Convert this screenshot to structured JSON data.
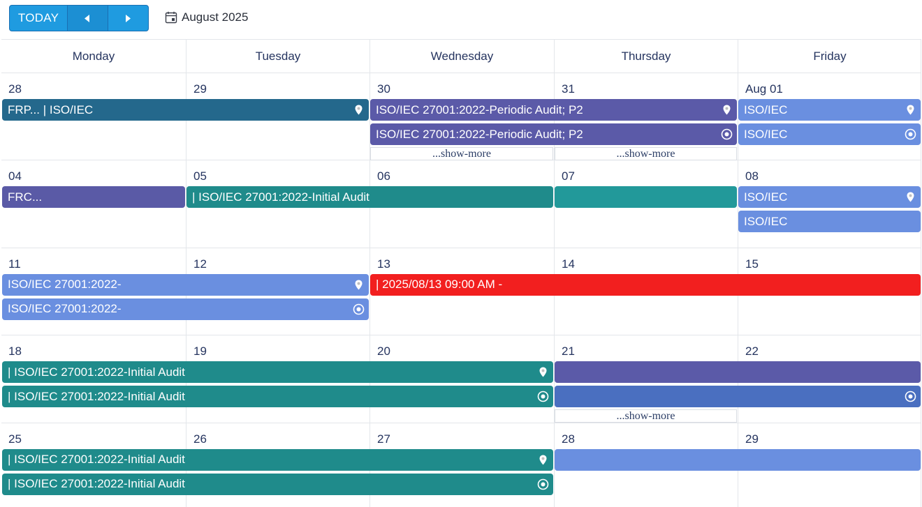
{
  "toolbar": {
    "today_label": "TODAY",
    "prev_icon": "triangle-left",
    "next_icon": "triangle-right",
    "calendar_icon": "calendar-icon",
    "month_label": "August 2025"
  },
  "weekdays": [
    "Monday",
    "Tuesday",
    "Wednesday",
    "Thursday",
    "Friday"
  ],
  "weeks": [
    {
      "days": [
        "28",
        "29",
        "30",
        "31",
        "Aug 01"
      ],
      "events": [
        {
          "col": 0,
          "span": 2,
          "lane": 0,
          "color": "#24688c",
          "title": "FRP...  | ISO/IEC",
          "icon": "location-pin-icon"
        },
        {
          "col": 2,
          "span": 2,
          "lane": 0,
          "color": "#5b5aa8",
          "title": "ISO/IEC 27001:2022-Periodic Audit; P2",
          "icon": "location-pin-icon"
        },
        {
          "col": 4,
          "span": 1,
          "lane": 0,
          "color": "#6a8fe0",
          "title": "ISO/IEC",
          "icon": "location-pin-icon"
        },
        {
          "col": 2,
          "span": 2,
          "lane": 1,
          "color": "#5b5aa8",
          "title": "ISO/IEC 27001:2022-Periodic Audit; P2",
          "icon": "target-icon"
        },
        {
          "col": 4,
          "span": 1,
          "lane": 1,
          "color": "#6a8fe0",
          "title": "ISO/IEC",
          "icon": "target-icon"
        }
      ],
      "more": [
        {
          "col": 2,
          "label": "...show-more"
        },
        {
          "col": 3,
          "label": "...show-more"
        }
      ]
    },
    {
      "days": [
        "04",
        "05",
        "06",
        "07",
        "08"
      ],
      "events": [
        {
          "col": 0,
          "span": 1,
          "lane": 0,
          "color": "#5a5aa6",
          "title": "FRC...",
          "icon": ""
        },
        {
          "col": 1,
          "span": 2,
          "lane": 0,
          "color": "#1f8b8b",
          "title": "| ISO/IEC 27001:2022-Initial Audit",
          "icon": ""
        },
        {
          "col": 3,
          "span": 1,
          "lane": 0,
          "color": "#22999a",
          "title": "",
          "icon": ""
        },
        {
          "col": 4,
          "span": 1,
          "lane": 0,
          "color": "#6a8fe0",
          "title": "ISO/IEC",
          "icon": "location-pin-icon"
        },
        {
          "col": 4,
          "span": 1,
          "lane": 1,
          "color": "#6a8fe0",
          "title": "ISO/IEC",
          "icon": ""
        }
      ],
      "more": []
    },
    {
      "days": [
        "11",
        "12",
        "13",
        "14",
        "15"
      ],
      "events": [
        {
          "col": 0,
          "span": 2,
          "lane": 0,
          "color": "#6a8fe0",
          "title": "ISO/IEC 27001:2022-",
          "icon": "location-pin-icon"
        },
        {
          "col": 2,
          "span": 3,
          "lane": 0,
          "color": "#f21f1f",
          "title": "| 2025/08/13 09:00 AM -",
          "icon": ""
        },
        {
          "col": 0,
          "span": 2,
          "lane": 1,
          "color": "#6a8fe0",
          "title": "ISO/IEC 27001:2022-",
          "icon": "target-icon"
        }
      ],
      "more": []
    },
    {
      "days": [
        "18",
        "19",
        "20",
        "21",
        "22"
      ],
      "events": [
        {
          "col": 0,
          "span": 3,
          "lane": 0,
          "color": "#1f8b8b",
          "title": "| ISO/IEC 27001:2022-Initial Audit",
          "icon": "location-pin-icon"
        },
        {
          "col": 3,
          "span": 2,
          "lane": 0,
          "color": "#5b5aa8",
          "title": "",
          "icon": ""
        },
        {
          "col": 0,
          "span": 3,
          "lane": 1,
          "color": "#1f8b8b",
          "title": "| ISO/IEC 27001:2022-Initial Audit",
          "icon": "target-icon"
        },
        {
          "col": 3,
          "span": 2,
          "lane": 1,
          "color": "#4a6fc0",
          "title": "",
          "icon": "target-icon"
        }
      ],
      "more": [
        {
          "col": 3,
          "label": "...show-more"
        }
      ]
    },
    {
      "days": [
        "25",
        "26",
        "27",
        "28",
        "29"
      ],
      "events": [
        {
          "col": 0,
          "span": 3,
          "lane": 0,
          "color": "#1f8b8b",
          "title": "| ISO/IEC 27001:2022-Initial Audit",
          "icon": "location-pin-icon"
        },
        {
          "col": 3,
          "span": 2,
          "lane": 0,
          "color": "#6a8fe0",
          "title": "",
          "icon": ""
        },
        {
          "col": 0,
          "span": 3,
          "lane": 1,
          "color": "#1f8b8b",
          "title": "| ISO/IEC 27001:2022-Initial Audit",
          "icon": "target-icon"
        }
      ],
      "more": []
    }
  ]
}
